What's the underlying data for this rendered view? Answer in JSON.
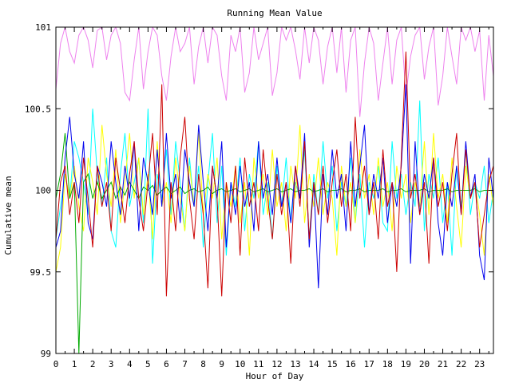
{
  "chart_data": {
    "type": "line",
    "title": "Running Mean Value",
    "xlabel": "Hour of Day",
    "ylabel": "Cumulative mean",
    "xlim": [
      0,
      23.75
    ],
    "ylim": [
      99,
      101
    ],
    "x_ticks": [
      "0",
      "1",
      "2",
      "3",
      "4",
      "5",
      "6",
      "7",
      "8",
      "9",
      "10",
      "11",
      "12",
      "13",
      "14",
      "15",
      "16",
      "17",
      "18",
      "19",
      "20",
      "21",
      "22",
      "23"
    ],
    "y_ticks": [
      "99",
      "99.5",
      "100",
      "100.5",
      "101"
    ],
    "grid": false,
    "legend": "none",
    "x": [
      0,
      0.25,
      0.5,
      0.75,
      1,
      1.25,
      1.5,
      1.75,
      2,
      2.25,
      2.5,
      2.75,
      3,
      3.25,
      3.5,
      3.75,
      4,
      4.25,
      4.5,
      4.75,
      5,
      5.25,
      5.5,
      5.75,
      6,
      6.25,
      6.5,
      6.75,
      7,
      7.25,
      7.5,
      7.75,
      8,
      8.25,
      8.5,
      8.75,
      9,
      9.25,
      9.5,
      9.75,
      10,
      10.25,
      10.5,
      10.75,
      11,
      11.25,
      11.5,
      11.75,
      12,
      12.25,
      12.5,
      12.75,
      13,
      13.25,
      13.5,
      13.75,
      14,
      14.25,
      14.5,
      14.75,
      15,
      15.25,
      15.5,
      15.75,
      16,
      16.25,
      16.5,
      16.75,
      17,
      17.25,
      17.5,
      17.75,
      18,
      18.25,
      18.5,
      18.75,
      19,
      19.25,
      19.5,
      19.75,
      20,
      20.25,
      20.5,
      20.75,
      21,
      21.25,
      21.5,
      21.75,
      22,
      22.25,
      22.5,
      22.75,
      23,
      23.25,
      23.5,
      23.75
    ],
    "series": [
      {
        "color": "#ee82ee",
        "values": [
          100.62,
          100.9,
          101.0,
          100.85,
          100.78,
          100.95,
          101.0,
          100.92,
          100.75,
          100.98,
          101.0,
          100.8,
          100.95,
          101.0,
          100.9,
          100.6,
          100.55,
          100.8,
          101.0,
          100.62,
          100.85,
          101.0,
          100.95,
          100.7,
          100.55,
          100.82,
          101.0,
          100.85,
          100.9,
          101.0,
          100.65,
          100.88,
          101.0,
          100.78,
          101.0,
          100.95,
          100.7,
          100.55,
          100.95,
          100.85,
          101.0,
          100.6,
          100.72,
          101.0,
          100.8,
          100.9,
          101.0,
          100.58,
          100.72,
          101.0,
          100.92,
          101.0,
          100.86,
          100.68,
          101.0,
          100.78,
          101.0,
          100.92,
          100.65,
          100.88,
          101.0,
          100.72,
          101.0,
          100.6,
          100.92,
          101.0,
          100.45,
          100.78,
          101.0,
          100.9,
          100.55,
          100.78,
          101.0,
          100.65,
          100.92,
          101.0,
          100.58,
          100.82,
          100.95,
          101.0,
          100.68,
          100.88,
          101.0,
          100.52,
          100.7,
          101.0,
          100.82,
          100.65,
          101.0,
          100.92,
          101.0,
          100.85,
          100.98,
          100.55,
          100.95,
          100.7
        ]
      },
      {
        "color": "#00ffff",
        "values": [
          99.7,
          99.9,
          100.1,
          99.95,
          100.3,
          100.2,
          100.05,
          99.85,
          100.5,
          100.1,
          99.9,
          100.2,
          99.75,
          99.65,
          100.1,
          100.35,
          99.9,
          100.05,
          100.2,
          99.8,
          100.5,
          99.55,
          100.1,
          99.95,
          100.25,
          99.85,
          100.3,
          100.05,
          99.75,
          100.2,
          99.9,
          100.15,
          99.65,
          100.05,
          100.35,
          99.8,
          100.15,
          99.6,
          100.05,
          99.9,
          100.2,
          99.75,
          100.1,
          99.95,
          100.3,
          99.85,
          100.05,
          99.7,
          100.15,
          99.9,
          100.2,
          99.8,
          100.05,
          99.95,
          100.25,
          99.7,
          100.1,
          99.85,
          100.3,
          99.95,
          100.15,
          99.75,
          100.05,
          99.9,
          100.2,
          99.8,
          100.1,
          99.65,
          100.05,
          99.95,
          100.15,
          99.8,
          99.75,
          100.3,
          99.95,
          100.1,
          99.85,
          100.05,
          99.9,
          100.55,
          99.75,
          100.1,
          99.95,
          100.2,
          99.8,
          100.05,
          99.6,
          100.15,
          99.9,
          100.25,
          99.85,
          100.05,
          99.95,
          100.15,
          99.8,
          100.0
        ]
      },
      {
        "color": "#ffff00",
        "values": [
          99.5,
          99.65,
          100.1,
          99.95,
          100.15,
          99.9,
          99.75,
          100.2,
          100.05,
          99.85,
          100.4,
          100.1,
          99.9,
          100.25,
          99.8,
          100.05,
          100.35,
          99.95,
          100.2,
          99.85,
          100.1,
          99.7,
          100.3,
          99.9,
          100.05,
          99.8,
          100.2,
          99.95,
          99.75,
          100.15,
          99.9,
          100.35,
          99.85,
          100.1,
          99.95,
          100.2,
          99.7,
          100.05,
          99.9,
          100.15,
          99.8,
          100.05,
          99.6,
          100.2,
          99.95,
          100.1,
          99.85,
          100.25,
          99.9,
          100.05,
          99.75,
          100.15,
          99.95,
          100.4,
          99.8,
          100.1,
          99.9,
          100.2,
          99.85,
          100.05,
          99.95,
          99.6,
          100.15,
          99.9,
          100.05,
          99.8,
          100.25,
          99.95,
          100.1,
          99.85,
          100.2,
          99.9,
          100.05,
          99.75,
          100.15,
          99.95,
          100.1,
          99.8,
          100.05,
          99.9,
          100.3,
          99.85,
          100.35,
          99.95,
          100.1,
          99.8,
          100.2,
          99.9,
          99.65,
          100.15,
          99.95,
          100.05,
          99.85,
          99.6,
          100.1,
          99.9
        ]
      },
      {
        "color": "#00aa00",
        "values": [
          99.95,
          100.1,
          100.35,
          99.95,
          100.05,
          99.0,
          100.05,
          100.1,
          99.95,
          100.05,
          99.95,
          100.0,
          100.05,
          99.95,
          100.02,
          99.97,
          100.05,
          100.0,
          99.95,
          100.02,
          100.0,
          100.03,
          99.97,
          100.0,
          100.02,
          99.98,
          100.0,
          100.02,
          99.98,
          100.0,
          100.01,
          99.99,
          100.0,
          100.02,
          99.98,
          100.0,
          100.01,
          99.99,
          100.0,
          100.01,
          99.99,
          100.0,
          100.01,
          99.99,
          100.0,
          100.01,
          99.99,
          100.0,
          100.01,
          99.99,
          100.0,
          100.01,
          99.99,
          100.0,
          100.0,
          100.01,
          99.99,
          100.0,
          100.01,
          99.99,
          100.0,
          100.0,
          100.01,
          99.99,
          100.0,
          100.0,
          100.01,
          99.99,
          100.0,
          100.0,
          100.0,
          100.01,
          99.99,
          100.0,
          100.0,
          100.01,
          99.99,
          100.0,
          100.0,
          100.0,
          100.01,
          99.99,
          100.0,
          100.0,
          100.0,
          100.01,
          99.99,
          100.0,
          100.0,
          100.0,
          100.0,
          100.01,
          99.99,
          100.0,
          100.0,
          100.0
        ]
      },
      {
        "color": "#0000ee",
        "values": [
          99.65,
          99.75,
          100.2,
          100.45,
          100.1,
          99.95,
          100.3,
          99.8,
          99.7,
          100.15,
          100.05,
          99.9,
          100.3,
          100.05,
          99.85,
          100.15,
          99.95,
          100.3,
          99.75,
          100.2,
          100.05,
          99.85,
          100.25,
          99.9,
          100.35,
          99.95,
          100.1,
          99.8,
          100.25,
          100.05,
          99.9,
          100.4,
          100.05,
          99.75,
          100.15,
          99.95,
          100.3,
          99.65,
          100.05,
          99.85,
          100.15,
          99.9,
          100.05,
          99.75,
          100.3,
          99.95,
          100.1,
          99.85,
          100.2,
          99.9,
          100.05,
          99.8,
          100.15,
          99.95,
          100.35,
          99.65,
          100.05,
          99.4,
          100.1,
          99.85,
          100.25,
          99.95,
          100.1,
          99.75,
          100.3,
          99.9,
          100.15,
          100.4,
          99.85,
          100.1,
          99.95,
          100.2,
          99.8,
          100.05,
          99.9,
          100.15,
          100.65,
          99.55,
          100.3,
          99.85,
          100.1,
          99.95,
          100.2,
          99.8,
          99.6,
          100.05,
          99.9,
          100.15,
          99.85,
          100.3,
          99.95,
          100.1,
          99.6,
          99.45,
          100.2,
          99.95
        ]
      },
      {
        "color": "#cc0000",
        "values": [
          99.7,
          100.05,
          100.15,
          99.85,
          100.05,
          99.8,
          100.2,
          99.95,
          99.65,
          100.15,
          99.9,
          100.05,
          99.75,
          100.2,
          100.0,
          99.8,
          100.1,
          100.3,
          99.95,
          99.75,
          100.05,
          100.35,
          99.85,
          100.65,
          99.35,
          100.05,
          99.75,
          100.2,
          100.45,
          99.95,
          99.7,
          100.1,
          99.85,
          99.4,
          100.15,
          99.95,
          99.35,
          100.05,
          99.8,
          100.15,
          99.6,
          100.2,
          99.9,
          100.05,
          99.75,
          100.25,
          99.95,
          99.7,
          100.1,
          99.85,
          100.05,
          99.55,
          100.15,
          99.9,
          100.3,
          99.7,
          100.05,
          99.85,
          100.15,
          99.8,
          100.05,
          100.25,
          99.9,
          100.1,
          99.75,
          100.45,
          99.95,
          100.15,
          99.85,
          100.05,
          99.7,
          100.25,
          99.9,
          100.05,
          99.5,
          100.2,
          100.85,
          99.95,
          100.1,
          99.85,
          100.05,
          99.55,
          100.2,
          99.9,
          100.05,
          99.75,
          100.1,
          100.35,
          99.85,
          100.25,
          99.95,
          100.05,
          99.65,
          99.85,
          100.05,
          100.15
        ]
      }
    ]
  }
}
